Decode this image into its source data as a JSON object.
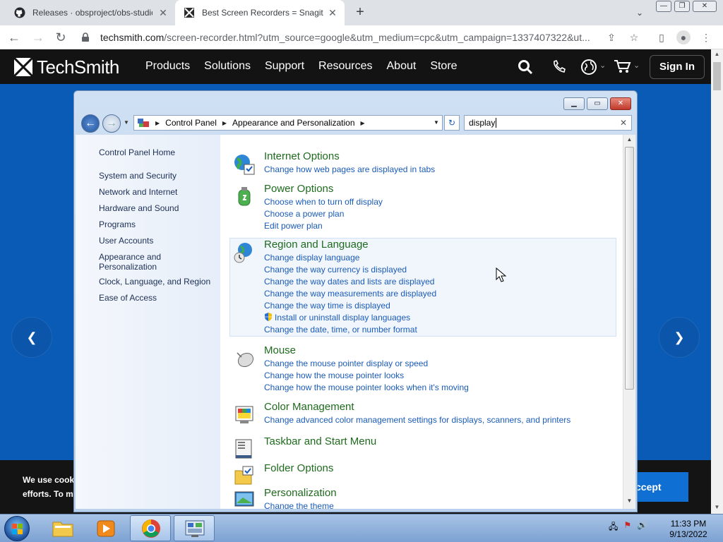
{
  "browser": {
    "tabs": [
      {
        "title": "Releases · obsproject/obs-studio",
        "favicon": "github-icon"
      },
      {
        "title": "Best Screen Recorders = Snagit",
        "favicon": "techsmith-icon"
      }
    ],
    "address": {
      "host": "techsmith.com",
      "path": "/screen-recorder.html?utm_source=google&utm_medium=cpc&utm_campaign=1337407322&ut..."
    }
  },
  "site": {
    "logo_text": "TechSmith",
    "nav": [
      "Products",
      "Solutions",
      "Support",
      "Resources",
      "About",
      "Store"
    ],
    "sign_in": "Sign In",
    "cookie_line1": "We use cook",
    "cookie_line2": "efforts. To m",
    "accept": "ccept"
  },
  "control_panel": {
    "breadcrumb": [
      "Control Panel",
      "Appearance and Personalization"
    ],
    "search_value": "display",
    "sidebar_home": "Control Panel Home",
    "sidebar_items": [
      "System and Security",
      "Network and Internet",
      "Hardware and Sound",
      "Programs",
      "User Accounts",
      "Appearance and Personalization",
      "Clock, Language, and Region",
      "Ease of Access"
    ],
    "categories": [
      {
        "title": "Internet Options",
        "icon": "internet-options-icon",
        "links": [
          "Change how web pages are displayed in tabs"
        ]
      },
      {
        "title": "Power Options",
        "icon": "power-options-icon",
        "links": [
          "Choose when to turn off display",
          "Choose a power plan",
          "Edit power plan"
        ]
      },
      {
        "title": "Region and Language",
        "icon": "region-language-icon",
        "links": [
          "Change display language",
          "Change the way currency is displayed",
          "Change the way dates and lists are displayed",
          "Change the way measurements are displayed",
          "Change the way time is displayed",
          "Install or uninstall display languages",
          "Change the date, time, or number format"
        ]
      },
      {
        "title": "Mouse",
        "icon": "mouse-icon",
        "links": [
          "Change the mouse pointer display or speed",
          "Change how the mouse pointer looks",
          "Change how the mouse pointer looks when it's moving"
        ]
      },
      {
        "title": "Color Management",
        "icon": "color-management-icon",
        "links": [
          "Change advanced color management settings for displays, scanners, and printers"
        ]
      },
      {
        "title": "Taskbar and Start Menu",
        "icon": "taskbar-icon",
        "links": []
      },
      {
        "title": "Folder Options",
        "icon": "folder-options-icon",
        "links": []
      },
      {
        "title": "Personalization",
        "icon": "personalization-icon",
        "links": [
          "Change the theme"
        ]
      }
    ]
  },
  "taskbar": {
    "time": "11:33 PM",
    "date": "9/13/2022"
  },
  "colors": {
    "site_blue": "#0a5bb5",
    "link_blue": "#1a5bb8",
    "heading_green": "#1e6b1e"
  }
}
